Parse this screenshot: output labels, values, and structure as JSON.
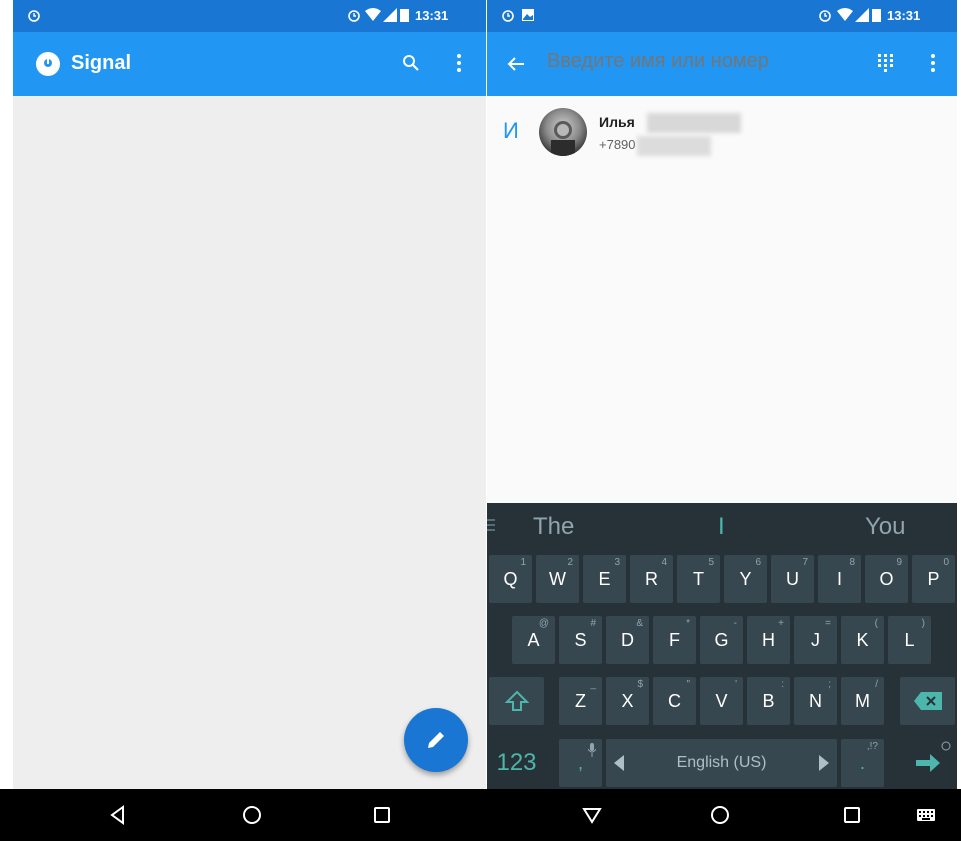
{
  "left_screen": {
    "status_bar": {
      "time": "13:31",
      "icons": [
        "alarm-icon",
        "wifi-icon",
        "signal-icon",
        "battery-icon"
      ]
    },
    "app_bar": {
      "title": "Signal",
      "icons": [
        "signal-logo-icon",
        "search-icon",
        "overflow-menu-icon"
      ]
    },
    "fab": {
      "icon": "pencil-icon"
    },
    "colors": {
      "status": "#1976d2",
      "appbar": "#2196f3",
      "background": "#eeeeee"
    }
  },
  "right_screen": {
    "status_bar": {
      "time": "13:31",
      "icons": [
        "alarm-icon",
        "image-icon",
        "alarm-icon",
        "wifi-icon",
        "signal-icon",
        "battery-icon"
      ]
    },
    "app_bar": {
      "search_placeholder": "Введите имя или номер",
      "icons": [
        "back-arrow-icon",
        "dialpad-icon",
        "overflow-menu-icon"
      ]
    },
    "contacts": [
      {
        "section_letter": "И",
        "name": "Илья ",
        "number": "+7890"
      }
    ],
    "keyboard": {
      "suggestions": [
        "The",
        "I",
        "You"
      ],
      "row1": [
        {
          "label": "Q",
          "hint": "1"
        },
        {
          "label": "W",
          "hint": "2"
        },
        {
          "label": "E",
          "hint": "3"
        },
        {
          "label": "R",
          "hint": "4"
        },
        {
          "label": "T",
          "hint": "5"
        },
        {
          "label": "Y",
          "hint": "6"
        },
        {
          "label": "U",
          "hint": "7"
        },
        {
          "label": "I",
          "hint": "8"
        },
        {
          "label": "O",
          "hint": "9"
        },
        {
          "label": "P",
          "hint": "0"
        }
      ],
      "row2": [
        {
          "label": "A",
          "hint": "@"
        },
        {
          "label": "S",
          "hint": "#"
        },
        {
          "label": "D",
          "hint": "&"
        },
        {
          "label": "F",
          "hint": "*"
        },
        {
          "label": "G",
          "hint": "-"
        },
        {
          "label": "H",
          "hint": "+"
        },
        {
          "label": "J",
          "hint": "="
        },
        {
          "label": "K",
          "hint": "("
        },
        {
          "label": "L",
          "hint": ")"
        }
      ],
      "row3": [
        {
          "label": "Z",
          "hint": "_"
        },
        {
          "label": "X",
          "hint": "$"
        },
        {
          "label": "C",
          "hint": "\""
        },
        {
          "label": "V",
          "hint": "'"
        },
        {
          "label": "B",
          "hint": ":"
        },
        {
          "label": "N",
          "hint": ";"
        },
        {
          "label": "M",
          "hint": "/"
        }
      ],
      "numbers_key": "123",
      "comma_key": ",",
      "space_label": "English (US)",
      "period_key": ".",
      "period_hint": ",!?"
    }
  },
  "nav_bar": {
    "left": [
      "back-icon",
      "home-icon",
      "recents-icon"
    ],
    "right": [
      "back-down-icon",
      "home-icon",
      "recents-icon",
      "keyboard-icon"
    ]
  }
}
